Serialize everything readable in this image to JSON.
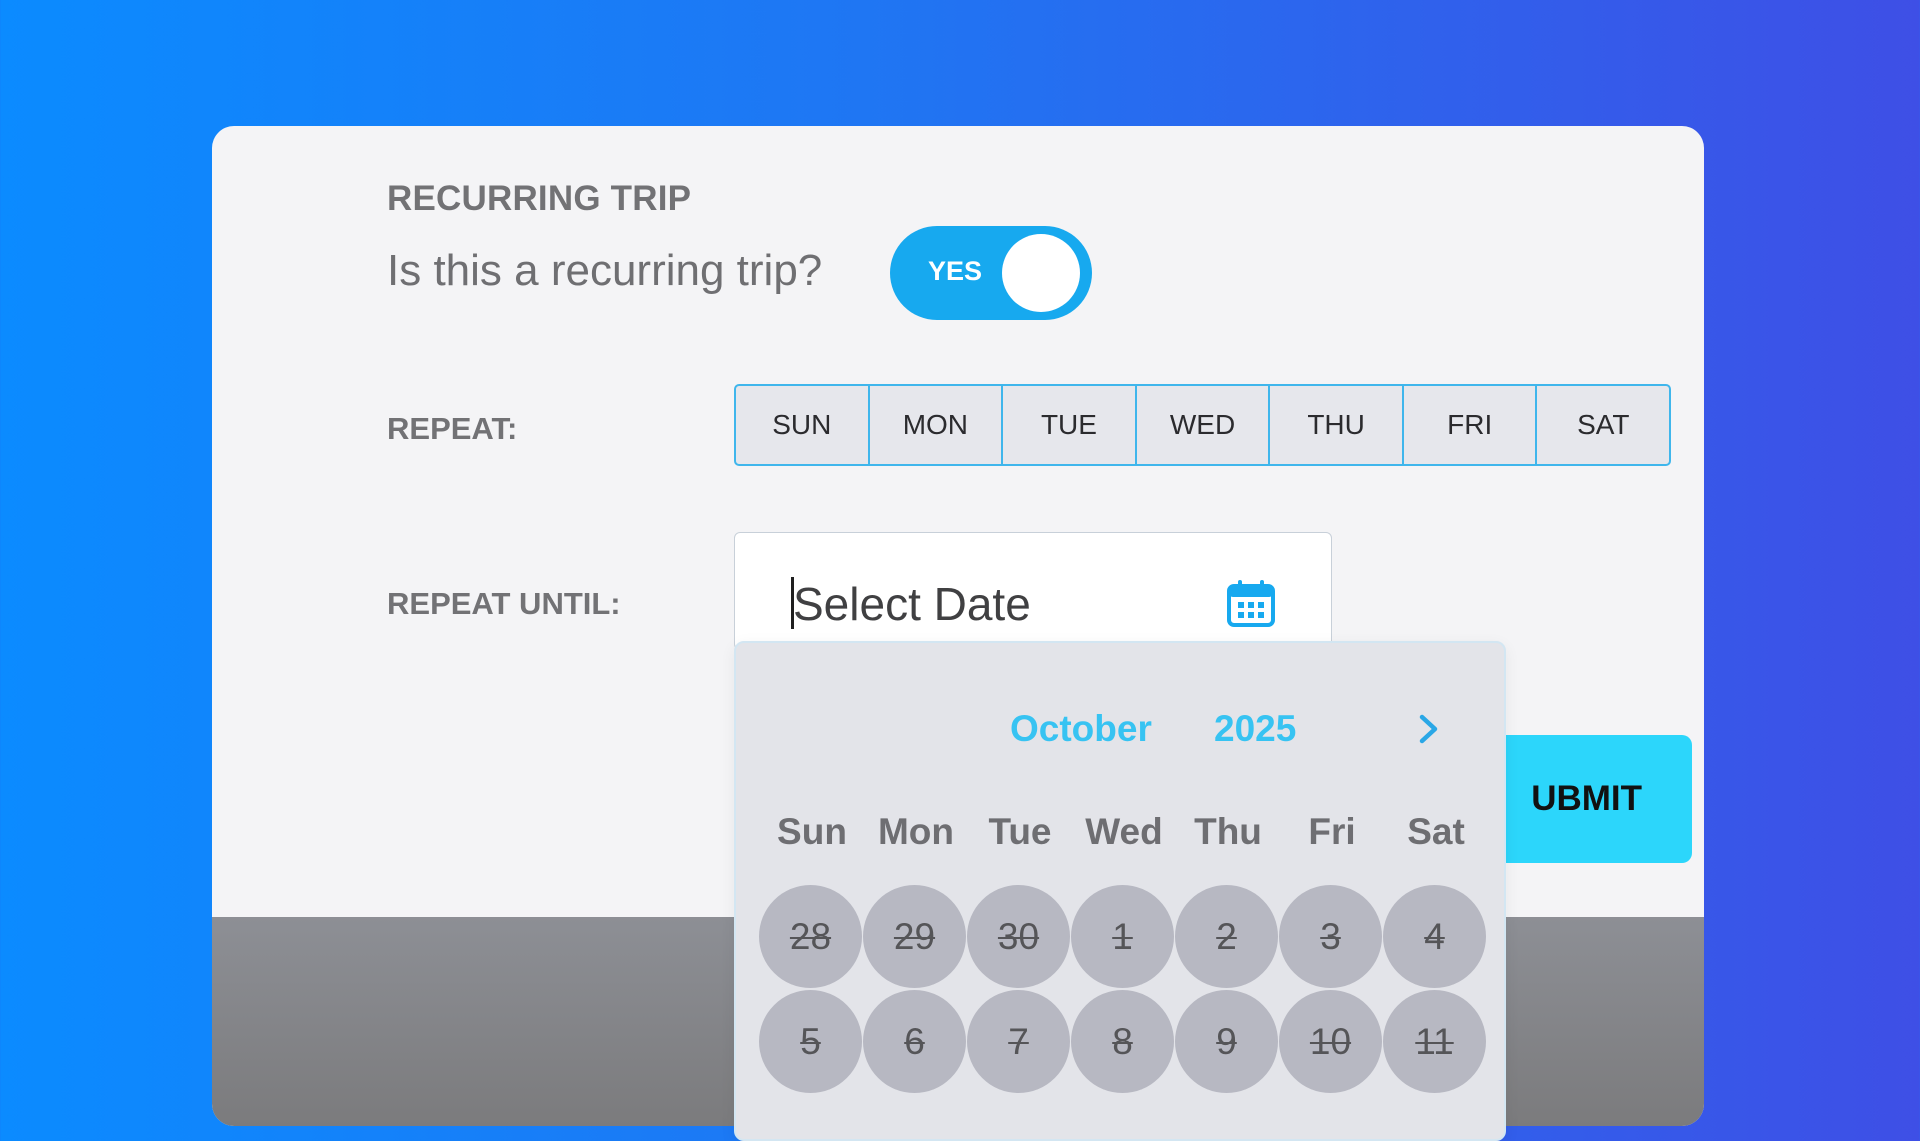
{
  "form": {
    "section_title": "RECURRING TRIP",
    "question": "Is this a recurring trip?",
    "toggle": {
      "label": "YES",
      "state": "on"
    },
    "repeat": {
      "label": "REPEAT:",
      "days": [
        "SUN",
        "MON",
        "TUE",
        "WED",
        "THU",
        "FRI",
        "SAT"
      ]
    },
    "repeat_until": {
      "label": "REPEAT UNTIL:",
      "placeholder": "Select Date",
      "icon": "calendar-icon"
    },
    "submit_label": "UBMIT"
  },
  "datepicker": {
    "month": "October",
    "year": "2025",
    "next_icon": "chevron-right-icon",
    "weekdays": [
      "Sun",
      "Mon",
      "Tue",
      "Wed",
      "Thu",
      "Fri",
      "Sat"
    ],
    "weeks": [
      [
        "28",
        "29",
        "30",
        "1",
        "2",
        "3",
        "4"
      ],
      [
        "5",
        "6",
        "7",
        "8",
        "9",
        "10",
        "11"
      ]
    ],
    "disabled": true
  },
  "colors": {
    "background_start": "#0b8bff",
    "background_end": "#3e4fe6",
    "accent": "#17a9ef",
    "submit": "#2cd6fb",
    "datepicker_header": "#37c3f2"
  }
}
